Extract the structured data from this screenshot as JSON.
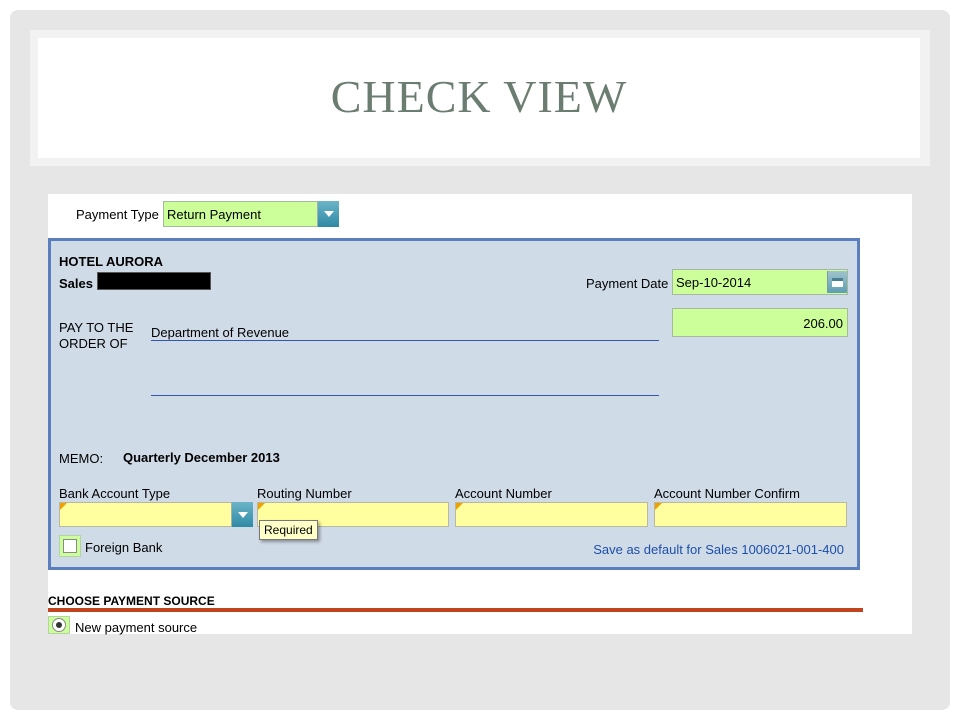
{
  "slide": {
    "title": "CHECK VIEW"
  },
  "payment_type": {
    "label": "Payment Type",
    "value": "Return Payment"
  },
  "check": {
    "company": "HOTEL AURORA",
    "sales_label": "Sales",
    "payment_date_label": "Payment Date",
    "payment_date_value": "Sep-10-2014",
    "pay_to_label_line1": "PAY TO THE",
    "pay_to_label_line2": "ORDER OF",
    "payee": "Department of Revenue",
    "amount": "206.00",
    "memo_label": "MEMO:",
    "memo_value": "Quarterly December 2013",
    "bank_account_type_label": "Bank Account Type",
    "routing_number_label": "Routing Number",
    "account_number_label": "Account Number",
    "account_number_confirm_label": "Account Number Confirm",
    "tooltip": "Required",
    "foreign_bank_label": "Foreign Bank",
    "save_default_link": "Save as default for Sales 1006021-001-400"
  },
  "payment_source": {
    "heading": "CHOOSE PAYMENT SOURCE",
    "option_new": "New payment source"
  },
  "colors": {
    "panel_bg": "#d0dbe8",
    "panel_border": "#5b7fbe",
    "required_field": "#ffff9f",
    "green_field": "#ccff99",
    "section_rule": "#c0441e",
    "title_text": "#6b7d70"
  }
}
